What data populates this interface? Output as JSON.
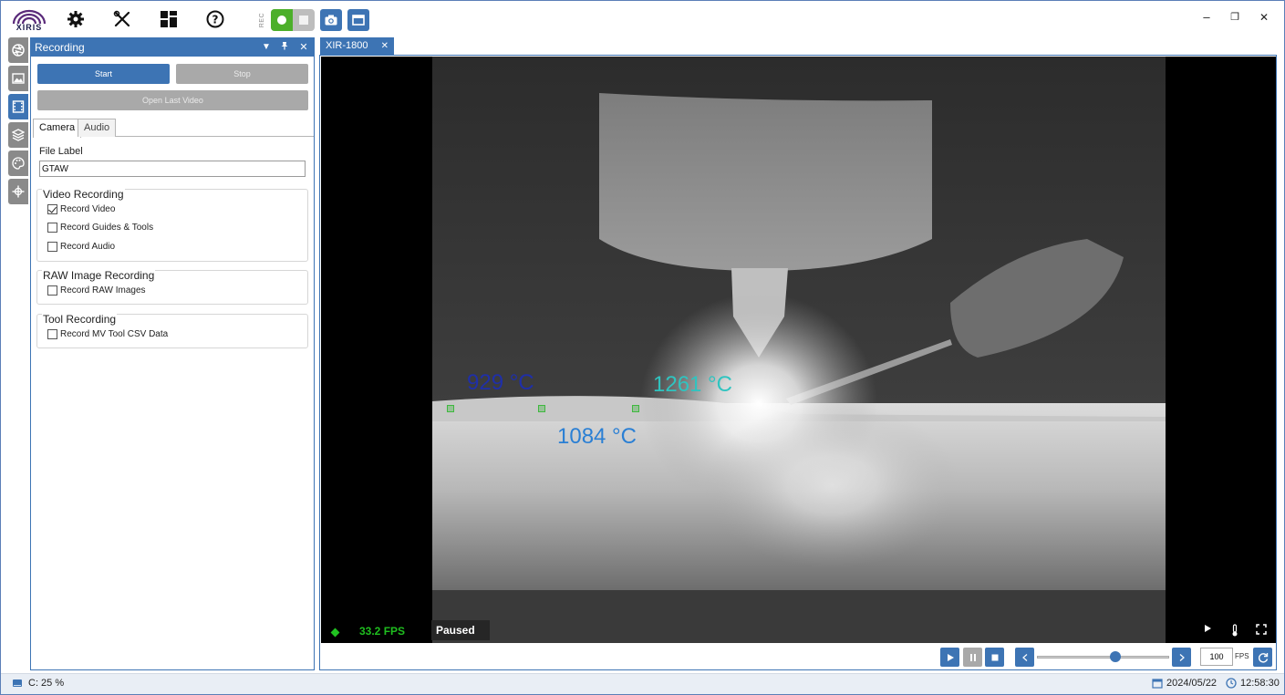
{
  "app": {
    "logo_text": "XIRIS",
    "toolbar": {
      "rec_label": "REC",
      "settings_icon": "gear-icon",
      "tools_icon": "tools-icon",
      "layout_icon": "layout-icon",
      "help_icon": "help-icon",
      "snapshot_icon": "camera-icon",
      "window_icon": "window-icon"
    },
    "window_controls": {
      "minimize": "–",
      "restore": "❐",
      "close": "✕"
    }
  },
  "sidebar": {
    "items": [
      {
        "name": "aperture",
        "icon": "aperture-icon"
      },
      {
        "name": "image",
        "icon": "image-icon"
      },
      {
        "name": "recording",
        "icon": "film-icon",
        "active": true
      },
      {
        "name": "layers",
        "icon": "layers-icon"
      },
      {
        "name": "palette",
        "icon": "palette-icon"
      },
      {
        "name": "crosshair",
        "icon": "crosshair-icon"
      }
    ]
  },
  "panel": {
    "title": "Recording",
    "start_label": "Start",
    "stop_label": "Stop",
    "open_last_label": "Open Last Video",
    "tabs": [
      {
        "label": "Camera",
        "active": true
      },
      {
        "label": "Audio",
        "active": false
      }
    ],
    "file_label": {
      "label": "File Label",
      "value": "GTAW"
    },
    "groups": {
      "video": {
        "title": "Video Recording",
        "items": [
          {
            "label": "Record Video",
            "checked": true
          },
          {
            "label": "Record Guides & Tools",
            "checked": false
          },
          {
            "label": "Record Audio",
            "checked": false
          }
        ]
      },
      "raw": {
        "title": "RAW Image Recording",
        "items": [
          {
            "label": "Record RAW Images",
            "checked": false
          }
        ]
      },
      "tool": {
        "title": "Tool Recording",
        "items": [
          {
            "label": "Record MV Tool CSV Data",
            "checked": false
          }
        ]
      }
    }
  },
  "viewer": {
    "tab_label": "XIR-1800",
    "tab_close": "✕",
    "temperatures": [
      {
        "label": "929 °C",
        "color": "#1f2fa8"
      },
      {
        "label": "1261 °C",
        "color": "#2fc4c0"
      },
      {
        "label": "1084 °C",
        "color": "#2a7fd4"
      }
    ],
    "fps_text": "33.2 FPS",
    "status_text": "Paused",
    "playback_fps": "100",
    "fps_unit": "FPS",
    "slider_position": 0.6
  },
  "statusbar": {
    "cpu": "C: 25 %",
    "date": "2024/05/22",
    "time": "12:58:30"
  },
  "colors": {
    "accent": "#3d74b4",
    "record_green": "#4caf2a",
    "fps_green": "#1fbe1f",
    "disabled_grey": "#a9a9a9"
  }
}
